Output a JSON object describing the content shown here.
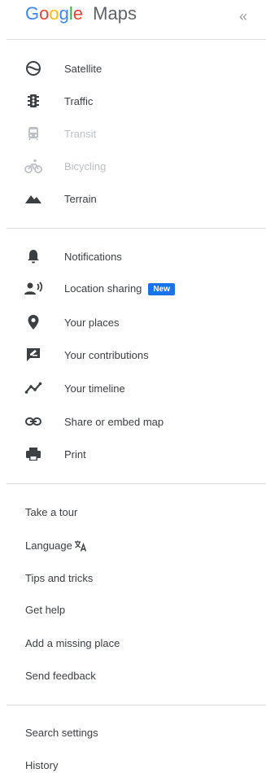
{
  "header": {
    "logo_letters": [
      {
        "ch": "G",
        "color": "#4285F4"
      },
      {
        "ch": "o",
        "color": "#EA4335"
      },
      {
        "ch": "o",
        "color": "#FBBC05"
      },
      {
        "ch": "g",
        "color": "#4285F4"
      },
      {
        "ch": "l",
        "color": "#34A853"
      },
      {
        "ch": "e",
        "color": "#EA4335"
      }
    ],
    "logo_suffix": "Maps",
    "collapse_glyph": "«"
  },
  "layers": [
    {
      "label": "Satellite",
      "icon": "satellite-icon",
      "enabled": true
    },
    {
      "label": "Traffic",
      "icon": "traffic-icon",
      "enabled": true
    },
    {
      "label": "Transit",
      "icon": "transit-icon",
      "enabled": false
    },
    {
      "label": "Bicycling",
      "icon": "bicycling-icon",
      "enabled": false
    },
    {
      "label": "Terrain",
      "icon": "terrain-icon",
      "enabled": true
    }
  ],
  "account": [
    {
      "label": "Notifications",
      "icon": "bell-icon"
    },
    {
      "label": "Location sharing",
      "icon": "location-sharing-icon",
      "badge": "New"
    },
    {
      "label": "Your places",
      "icon": "map-pin-icon"
    },
    {
      "label": "Your contributions",
      "icon": "contributions-icon"
    },
    {
      "label": "Your timeline",
      "icon": "timeline-icon"
    },
    {
      "label": "Share or embed map",
      "icon": "link-icon"
    },
    {
      "label": "Print",
      "icon": "printer-icon"
    }
  ],
  "help": [
    {
      "label": "Take a tour"
    },
    {
      "label": "Language",
      "icon": "translate-icon"
    },
    {
      "label": "Tips and tricks"
    },
    {
      "label": "Get help"
    },
    {
      "label": "Add a missing place"
    },
    {
      "label": "Send feedback"
    }
  ],
  "settings": [
    {
      "label": "Search settings"
    },
    {
      "label": "History"
    }
  ],
  "colors": {
    "icon_dark": "#3c4043",
    "icon_disabled": "#bdc1c6",
    "badge_blue": "#1a73e8",
    "divider": "#dadce0"
  }
}
